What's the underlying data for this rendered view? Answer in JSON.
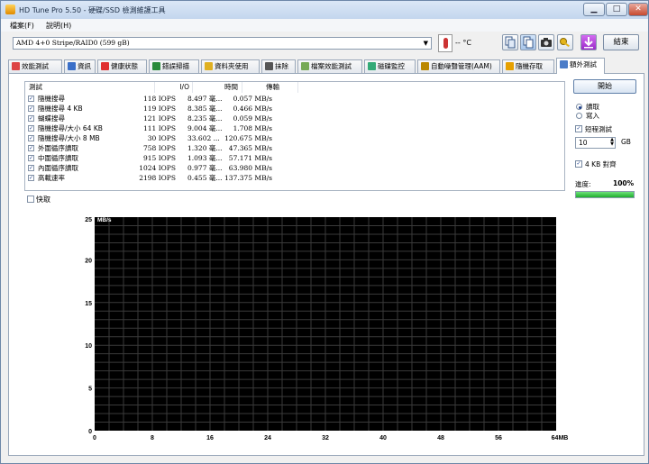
{
  "window": {
    "title": "HD Tune Pro 5.50 - 硬碟/SSD 檢測維護工具",
    "min": "▁",
    "max": "□",
    "close": "✕"
  },
  "menu": [
    "檔案(F)",
    "說明(H)"
  ],
  "toolbar": {
    "drive": "AMD    4+0 Stripe/RAID0 (599 gB)",
    "temperature": "-- °C",
    "exit_label": "結束"
  },
  "tabs": [
    {
      "label": "效能測試",
      "icon_color": "#d44"
    },
    {
      "label": "資訊",
      "icon_color": "#3a6fc8"
    },
    {
      "label": "健康狀態",
      "icon_color": "#e03030"
    },
    {
      "label": "錯誤掃描",
      "icon_color": "#2a8a3a"
    },
    {
      "label": "資料夾使用",
      "icon_color": "#e0b020"
    },
    {
      "label": "抹除",
      "icon_color": "#555"
    },
    {
      "label": "檔案效能測試",
      "icon_color": "#7a5"
    },
    {
      "label": "磁碟監控",
      "icon_color": "#3a7"
    },
    {
      "label": "自動噪聲管理(AAM)",
      "icon_color": "#b80"
    },
    {
      "label": "隨機存取",
      "icon_color": "#e6a000"
    },
    {
      "label": "額外測試",
      "icon_color": "#4a7cc8"
    }
  ],
  "table": {
    "headers": {
      "test": "測試",
      "io": "I/O",
      "time": "時間",
      "rate": "傳輸"
    },
    "rows": [
      {
        "name": "隨機搜尋",
        "io": "118 IOPS",
        "time": "8.497 毫...",
        "rate": "0.057 MB/s"
      },
      {
        "name": "隨機搜尋 4 KB",
        "io": "119 IOPS",
        "time": "8.385 毫...",
        "rate": "0.466 MB/s"
      },
      {
        "name": "蝴蝶搜尋",
        "io": "121 IOPS",
        "time": "8.235 毫...",
        "rate": "0.059 MB/s"
      },
      {
        "name": "隨機搜尋/大小 64 KB",
        "io": "111 IOPS",
        "time": "9.004 毫...",
        "rate": "1.708 MB/s"
      },
      {
        "name": "隨機搜尋/大小 8 MB",
        "io": "30 IOPS",
        "time": "33.602 ...",
        "rate": "120.675 MB/s"
      },
      {
        "name": "外圍循序讀取",
        "io": "758 IOPS",
        "time": "1.320 毫...",
        "rate": "47.365 MB/s"
      },
      {
        "name": "中圍循序讀取",
        "io": "915 IOPS",
        "time": "1.093 毫...",
        "rate": "57.171 MB/s"
      },
      {
        "name": "內圍循序讀取",
        "io": "1024 IOPS",
        "time": "0.977 毫...",
        "rate": "63.980 MB/s"
      },
      {
        "name": "高載速率",
        "io": "2198 IOPS",
        "time": "0.455 毫...",
        "rate": "137.375 MB/s"
      }
    ]
  },
  "fast_label": "快取",
  "side": {
    "start_label": "開始",
    "read_label": "讀取",
    "write_label": "寫入",
    "short_test_label": "短程測試",
    "size_value": "10",
    "size_unit": "GB",
    "align_label": "4 KB 對齊",
    "progress_label": "進度:",
    "progress_value": "100%",
    "progress_fraction": 1.0
  },
  "chart_data": {
    "type": "line",
    "ylabel": "MB/s",
    "ylim": [
      0,
      25
    ],
    "yticks": [
      "0",
      "5",
      "10",
      "15",
      "20",
      "25"
    ],
    "xlim": [
      0,
      64
    ],
    "xticks": [
      "0",
      "8",
      "16",
      "24",
      "32",
      "40",
      "48",
      "56",
      "64MB"
    ],
    "series": [],
    "grid": true
  }
}
